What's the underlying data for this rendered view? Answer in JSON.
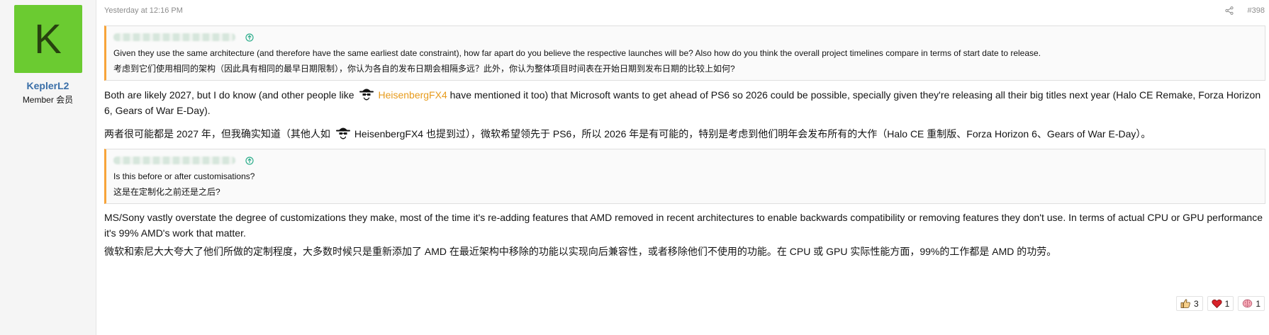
{
  "author": {
    "avatar_letter": "K",
    "avatar_color": "#6bcb31",
    "username": "KeplerL2",
    "title": "Member  会员"
  },
  "header": {
    "timestamp": "Yesterday at 12:16 PM",
    "post_number": "#398",
    "share_icon": "share-icon"
  },
  "quote1": {
    "author_blurred": true,
    "line_en": "Given they use the same architecture (and therefore have the same earliest date constraint), how far apart do you believe the respective launches will be? Also how do you think the overall project timelines compare in terms of start date to release.",
    "line_zh": "考虑到它们使用相同的架构（因此具有相同的最早日期限制），你认为各自的发布日期会相隔多远？此外，你认为整体项目时间表在开始日期到发布日期的比较上如何?"
  },
  "body1": {
    "en_a": "Both are likely 2027, but I do know (and other people like ",
    "mention": "HeisenbergFX4",
    "en_b": " have mentioned it too) that Microsoft wants to get ahead of PS6 so 2026 could be possible, specially given they're releasing all their big titles next year (Halo CE Remake, Forza Horizon 6, Gears of War E-Day).",
    "zh_a": "两者很可能都是 2027 年，但我确实知道（其他人如 ",
    "zh_mention": "HeisenbergFX4",
    "zh_b": " 也提到过），微软希望领先于 PS6，所以 2026 年是有可能的，特别是考虑到他们明年会发布所有的大作（Halo CE 重制版、Forza Horizon 6、Gears of War E-Day）。"
  },
  "quote2": {
    "author_blurred": true,
    "line_en": "Is this before or after customisations?",
    "line_zh": "这是在定制化之前还是之后?"
  },
  "body2": {
    "en": "MS/Sony vastly overstate the degree of customizations they make, most of the time it's re-adding features that AMD removed in recent architectures to enable backwards compatibility or removing features they don't use. In terms of actual CPU or GPU performance it's 99% AMD's work that matter.",
    "zh": "微软和索尼大大夸大了他们所做的定制程度，大多数时候只是重新添加了 AMD 在最近架构中移除的功能以实现向后兼容性，或者移除他们不使用的功能。在 CPU 或 GPU 实际性能方面，99%的工作都是 AMD 的功劳。"
  },
  "reactions": [
    {
      "icon": "thumbs-up-icon",
      "count": "3"
    },
    {
      "icon": "heart-icon",
      "count": "1"
    },
    {
      "icon": "brain-icon",
      "count": "1"
    }
  ],
  "colors": {
    "accent_orange": "#f7a43a",
    "mention": "#e79b1c",
    "username": "#3a6fa8"
  }
}
